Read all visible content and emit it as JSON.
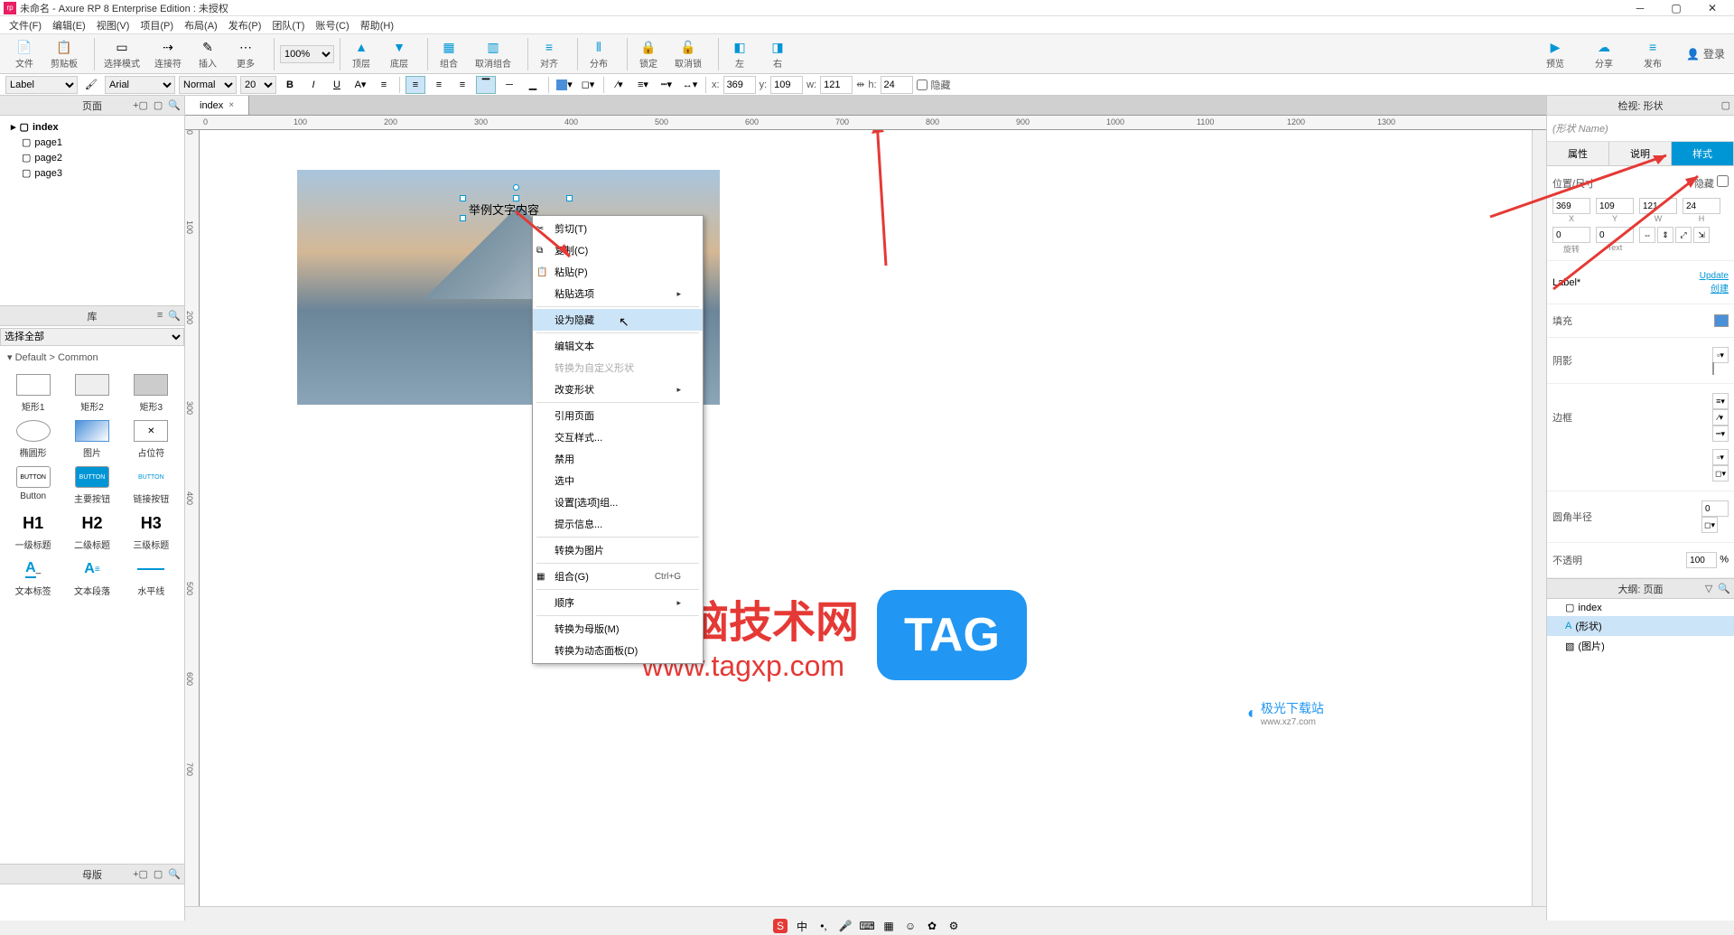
{
  "window": {
    "title": "未命名 - Axure RP 8 Enterprise Edition : 未授权"
  },
  "menu": [
    "文件(F)",
    "编辑(E)",
    "视图(V)",
    "项目(P)",
    "布局(A)",
    "发布(P)",
    "团队(T)",
    "账号(C)",
    "帮助(H)"
  ],
  "toolbar": {
    "zoom": "100%",
    "groups": [
      "文件",
      "剪贴板",
      "选择模式",
      "连接符",
      "插入",
      "更多",
      "顶层",
      "底层",
      "组合",
      "取消组合",
      "对齐",
      "分布",
      "锁定",
      "取消锁",
      "左",
      "右"
    ],
    "right_groups": [
      "预览",
      "分享",
      "发布"
    ],
    "login": "登录"
  },
  "format_bar": {
    "style_select": "Label",
    "font": "Arial",
    "weight": "Normal",
    "size": "20",
    "x_label": "x:",
    "x": "369",
    "y_label": "y:",
    "y": "109",
    "w_label": "w:",
    "w": "121",
    "h_label": "h:",
    "h": "24",
    "hidden_label": "隐藏"
  },
  "pages_panel": {
    "title": "页面",
    "items": [
      "index",
      "page1",
      "page2",
      "page3"
    ]
  },
  "library_panel": {
    "title": "库",
    "select": "选择全部",
    "group_label": "Default > Common",
    "items": [
      {
        "label": "矩形1",
        "shape": "rect"
      },
      {
        "label": "矩形2",
        "shape": "rect-gray"
      },
      {
        "label": "矩形3",
        "shape": "rect-dark"
      },
      {
        "label": "椭圆形",
        "shape": "ellipse"
      },
      {
        "label": "图片",
        "shape": "image"
      },
      {
        "label": "占位符",
        "shape": "placeholder"
      },
      {
        "label": "Button",
        "shape": "button"
      },
      {
        "label": "主要按钮",
        "shape": "button-primary"
      },
      {
        "label": "链接按钮",
        "shape": "button-link"
      },
      {
        "label": "一级标题",
        "shape": "H1"
      },
      {
        "label": "二级标题",
        "shape": "H2"
      },
      {
        "label": "三级标题",
        "shape": "H3"
      },
      {
        "label": "文本标签",
        "shape": "A_"
      },
      {
        "label": "文本段落",
        "shape": "A≡"
      },
      {
        "label": "水平线",
        "shape": "hr"
      }
    ]
  },
  "master_panel": {
    "title": "母版"
  },
  "canvas": {
    "tab_name": "index",
    "ruler_ticks": [
      "0",
      "100",
      "200",
      "300",
      "400",
      "500",
      "600",
      "700",
      "800",
      "900",
      "1000",
      "1100",
      "1200",
      "1300"
    ],
    "selected_text": "举例文字内容"
  },
  "context_menu": {
    "items": [
      {
        "label": "剪切(T)",
        "icon": "✂"
      },
      {
        "label": "复制(C)",
        "icon": "⧉"
      },
      {
        "label": "粘贴(P)",
        "icon": "📋"
      },
      {
        "label": "粘贴选项",
        "submenu": true
      },
      {
        "sep": true
      },
      {
        "label": "设为隐藏",
        "highlight": true
      },
      {
        "sep": true
      },
      {
        "label": "编辑文本"
      },
      {
        "label": "转换为自定义形状",
        "disabled": true
      },
      {
        "label": "改变形状",
        "submenu": true
      },
      {
        "sep": true
      },
      {
        "label": "引用页面"
      },
      {
        "label": "交互样式..."
      },
      {
        "label": "禁用"
      },
      {
        "label": "选中"
      },
      {
        "label": "设置[选项]组..."
      },
      {
        "label": "提示信息..."
      },
      {
        "sep": true
      },
      {
        "label": "转换为图片"
      },
      {
        "sep": true
      },
      {
        "label": "组合(G)",
        "icon": "▦",
        "shortcut": "Ctrl+G"
      },
      {
        "sep": true
      },
      {
        "label": "顺序",
        "submenu": true
      },
      {
        "sep": true
      },
      {
        "label": "转换为母版(M)"
      },
      {
        "label": "转换为动态面板(D)"
      }
    ]
  },
  "right_panel": {
    "title": "检视: 形状",
    "name_placeholder": "(形状 Name)",
    "tabs": [
      "属性",
      "说明",
      "样式"
    ],
    "pos_label": "位置/尺寸",
    "hidden_label": "隐藏",
    "x": "369",
    "y": "109",
    "w": "121",
    "h": "24",
    "x_lbl": "X",
    "y_lbl": "Y",
    "w_lbl": "W",
    "h_lbl": "H",
    "rotate": "0",
    "rotate2": "0",
    "rotate_lbl": "旋转",
    "text_lbl": "Text",
    "style_name": "Label*",
    "update_link": "Update",
    "create_link": "创建",
    "fill_label": "填充",
    "shadow_label": "阴影",
    "border_label": "边框",
    "radius_label": "圆角半径",
    "radius": "0",
    "opacity_label": "不透明",
    "opacity": "100",
    "opacity_unit": "%",
    "outline_title": "大纲: 页面",
    "outline_items": [
      {
        "label": "index",
        "icon": "page"
      },
      {
        "label": "(形状)",
        "icon": "A",
        "selected": true
      },
      {
        "label": "(图片)",
        "icon": "img"
      }
    ]
  },
  "watermark": {
    "line1": "电脑技术网",
    "line2": "www.tagxp.com",
    "tag": "TAG",
    "logo2": "极光下载站",
    "logo2_url": "www.xz7.com"
  }
}
